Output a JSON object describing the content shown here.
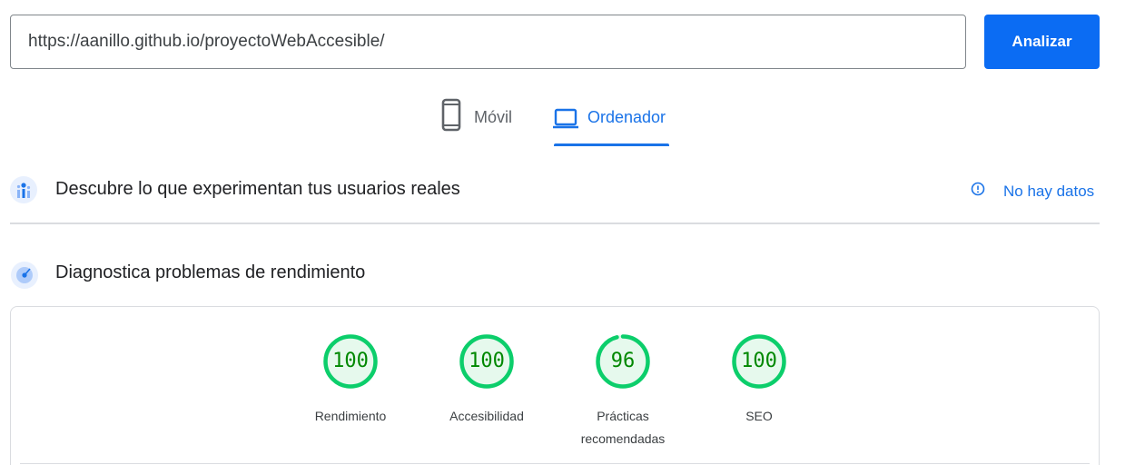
{
  "search": {
    "url_value": "https://aanillo.github.io/proyectoWebAccesible/",
    "analyze_label": "Analizar"
  },
  "tabs": [
    {
      "label": "Móvil",
      "icon": "smartphone-icon",
      "active": false
    },
    {
      "label": "Ordenador",
      "icon": "laptop-icon",
      "active": true
    }
  ],
  "field_data": {
    "title": "Descubre lo que experimentan tus usuarios reales",
    "icon": "users-chart-icon",
    "status_label": "No hay datos",
    "status_icon": "info-icon"
  },
  "lab_data": {
    "title": "Diagnostica problemas de rendimiento",
    "icon": "radar-icon"
  },
  "scores": [
    {
      "value": "100",
      "fraction": 1.0,
      "label": "Rendimiento"
    },
    {
      "value": "100",
      "fraction": 1.0,
      "label": "Accesibilidad"
    },
    {
      "value": "96",
      "fraction": 0.96,
      "label": "Prácticas recomendadas"
    },
    {
      "value": "100",
      "fraction": 1.0,
      "label": "SEO"
    }
  ],
  "colors": {
    "accent": "#1a73e8",
    "button": "#0b6cf3",
    "pass": "#0cce6b",
    "pass_text": "#008800"
  }
}
